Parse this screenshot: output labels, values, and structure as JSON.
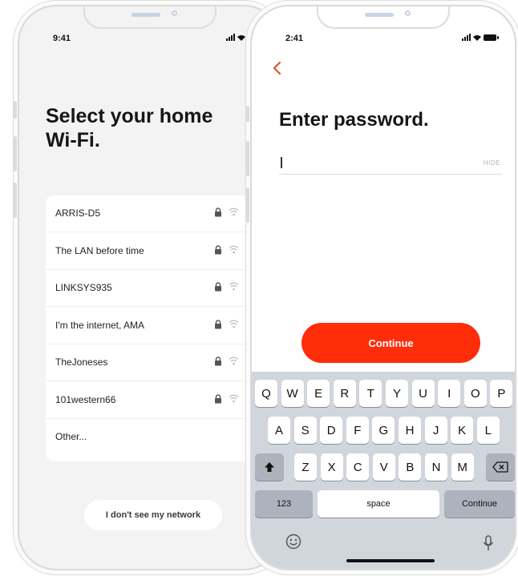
{
  "left_screen": {
    "status_time": "9:41",
    "title_line1": "Select your home",
    "title_line2": "Wi-Fi.",
    "networks": [
      {
        "name": "ARRIS-D5",
        "locked": true
      },
      {
        "name": "The LAN before time",
        "locked": true
      },
      {
        "name": "LINKSYS935",
        "locked": true
      },
      {
        "name": "I'm the internet, AMA",
        "locked": true
      },
      {
        "name": "TheJoneses",
        "locked": true
      },
      {
        "name": "101western66",
        "locked": true
      },
      {
        "name": "Other...",
        "locked": false
      }
    ],
    "no_network_label": "I don't see my network"
  },
  "right_screen": {
    "status_time": "2:41",
    "title": "Enter password.",
    "password_value": "",
    "hide_label": "HIDE",
    "continue_label": "Continue",
    "keyboard": {
      "row1": [
        "Q",
        "W",
        "E",
        "R",
        "T",
        "Y",
        "U",
        "I",
        "O",
        "P"
      ],
      "row2": [
        "A",
        "S",
        "D",
        "F",
        "G",
        "H",
        "J",
        "K",
        "L"
      ],
      "row3": [
        "Z",
        "X",
        "C",
        "V",
        "B",
        "N",
        "M"
      ],
      "numbers_label": "123",
      "space_label": "space",
      "return_label": "Continue"
    }
  },
  "colors": {
    "accent": "#ff2d0a",
    "back_arrow": "#e0522b",
    "keyboard_bg": "#d1d5dc"
  }
}
